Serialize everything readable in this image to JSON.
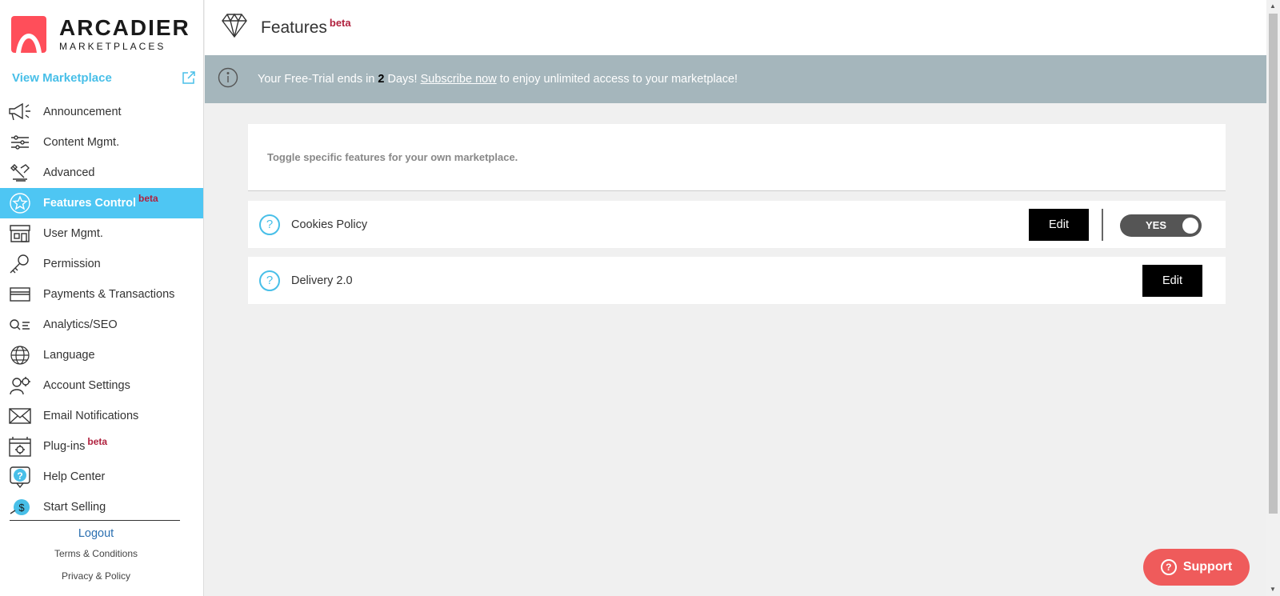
{
  "brand": {
    "title": "ARCADIER",
    "subtitle": "MARKETPLACES",
    "color": "#ff4e5a"
  },
  "sidebar": {
    "view_marketplace": "View Marketplace",
    "items": [
      {
        "label": "Announcement",
        "icon": "megaphone-icon"
      },
      {
        "label": "Content Mgmt.",
        "icon": "sliders-icon"
      },
      {
        "label": "Advanced",
        "icon": "tools-icon"
      },
      {
        "label": "Features Control",
        "icon": "star-icon",
        "badge": "beta",
        "active": true
      },
      {
        "label": "User Mgmt.",
        "icon": "store-icon"
      },
      {
        "label": "Permission",
        "icon": "key-icon"
      },
      {
        "label": "Payments & Transactions",
        "icon": "card-icon"
      },
      {
        "label": "Analytics/SEO",
        "icon": "magnifier-icon"
      },
      {
        "label": "Language",
        "icon": "globe-icon"
      },
      {
        "label": "Account Settings",
        "icon": "user-gear-icon"
      },
      {
        "label": "Email Notifications",
        "icon": "envelope-icon"
      },
      {
        "label": "Plug-ins",
        "icon": "plugin-icon",
        "badge": "beta"
      },
      {
        "label": "Help Center",
        "icon": "help-icon"
      },
      {
        "label": "Start Selling",
        "icon": "dollar-icon"
      }
    ],
    "logout": "Logout",
    "terms": "Terms & Conditions",
    "privacy": "Privacy & Policy",
    "active_color": "#4ec6f3"
  },
  "header": {
    "title": "Features",
    "badge": "beta"
  },
  "banner": {
    "text_before": "Your Free-Trial ends in",
    "days": "2",
    "days_suffix": "Days!",
    "link": "Subscribe now",
    "text_after": "to enjoy unlimited access to your marketplace!"
  },
  "intro": {
    "text": "Toggle specific features for your own marketplace."
  },
  "features": [
    {
      "name": "Cookies Policy",
      "edit_label": "Edit",
      "toggle_label": "YES",
      "toggle_on": true
    },
    {
      "name": "Delivery 2.0",
      "edit_label": "Edit"
    }
  ],
  "support": {
    "label": "Support",
    "color": "#ef5b5b"
  }
}
